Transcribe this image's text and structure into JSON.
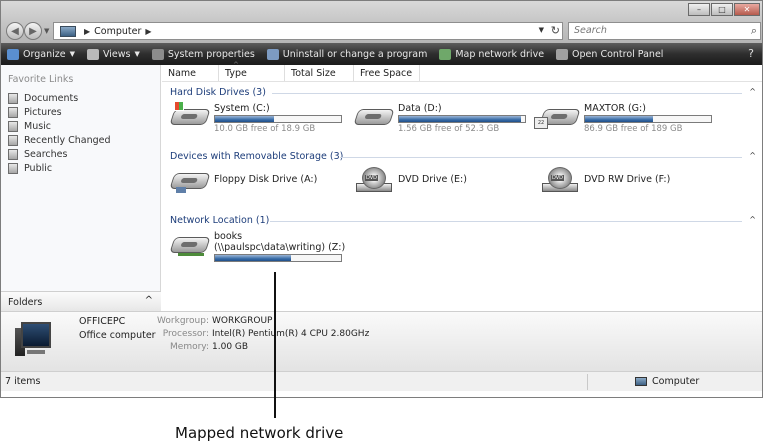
{
  "window": {
    "address": {
      "location": "Computer"
    },
    "search": {
      "placeholder": "Search"
    }
  },
  "toolbar": {
    "items": [
      {
        "label": "Organize",
        "has_dropdown": true,
        "icon": "organize-icon"
      },
      {
        "label": "Views",
        "has_dropdown": true,
        "icon": "views-icon"
      },
      {
        "label": "System properties",
        "icon": "system-properties-icon"
      },
      {
        "label": "Uninstall or change a program",
        "icon": "uninstall-icon"
      },
      {
        "label": "Map network drive",
        "icon": "map-network-drive-icon"
      },
      {
        "label": "Open Control Panel",
        "icon": "control-panel-icon"
      }
    ]
  },
  "sidebar": {
    "header": "Favorite Links",
    "items": [
      {
        "label": "Documents"
      },
      {
        "label": "Pictures"
      },
      {
        "label": "Music"
      },
      {
        "label": "Recently Changed"
      },
      {
        "label": "Searches"
      },
      {
        "label": "Public"
      }
    ],
    "folders_label": "Folders"
  },
  "columns": [
    "Name",
    "Type",
    "Total Size",
    "Free Space"
  ],
  "groups": {
    "hard_disk": {
      "title": "Hard Disk Drives (3)",
      "drives": [
        {
          "name": "System (C:)",
          "free": "10.0 GB free of 18.9 GB",
          "used_fraction": 0.47
        },
        {
          "name": "Data (D:)",
          "free": "1.56 GB free of 52.3 GB",
          "used_fraction": 0.97
        },
        {
          "name": "MAXTOR (G:)",
          "free": "86.9 GB free of 189 GB",
          "used_fraction": 0.54
        }
      ]
    },
    "removable": {
      "title": "Devices with Removable Storage (3)",
      "drives": [
        {
          "name": "Floppy Disk Drive (A:)"
        },
        {
          "name": "DVD Drive (E:)"
        },
        {
          "name": "DVD RW Drive (F:)"
        }
      ]
    },
    "network": {
      "title": "Network Location (1)",
      "drives": [
        {
          "name_line1": "books",
          "name_line2": "(\\\\paulspc\\data\\writing) (Z:)",
          "used_fraction": 0.6
        }
      ]
    }
  },
  "details": {
    "computer_name": "OFFICEPC",
    "description": "Office computer",
    "properties": [
      {
        "key": "Workgroup:",
        "value": "WORKGROUP"
      },
      {
        "key": "Processor:",
        "value": "Intel(R) Pentium(R) 4 CPU 2.80GHz"
      },
      {
        "key": "Memory:",
        "value": "1.00 GB"
      }
    ]
  },
  "statusbar": {
    "item_count": "7 items",
    "location": "Computer"
  },
  "annotation": {
    "callout": "Mapped network drive"
  }
}
